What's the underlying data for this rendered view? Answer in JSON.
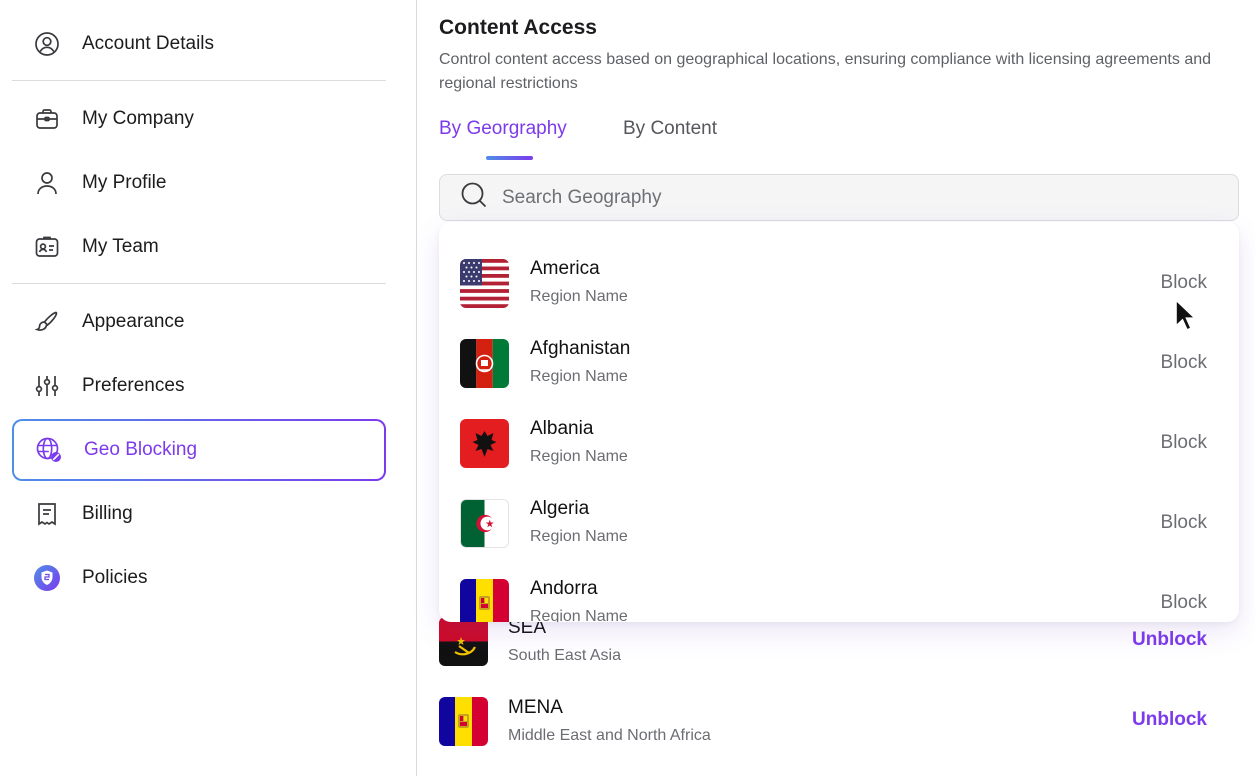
{
  "sidebar": {
    "items": [
      {
        "label": "Account Details",
        "icon": "user-circle-icon"
      },
      {
        "label": "My Company",
        "icon": "briefcase-icon"
      },
      {
        "label": "My Profile",
        "icon": "person-icon"
      },
      {
        "label": "My Team",
        "icon": "id-badge-icon"
      },
      {
        "label": "Appearance",
        "icon": "brush-icon"
      },
      {
        "label": "Preferences",
        "icon": "sliders-icon"
      },
      {
        "label": "Geo Blocking",
        "icon": "globe-block-icon"
      },
      {
        "label": "Billing",
        "icon": "receipt-icon"
      },
      {
        "label": "Policies",
        "icon": "shield-icon"
      }
    ],
    "active": "Geo Blocking"
  },
  "main": {
    "title": "Content Access",
    "subtitle": "Control content access based on geographical locations, ensuring compliance with licensing agreements and regional restrictions",
    "tabs": [
      {
        "label": "By Georgraphy",
        "active": true
      },
      {
        "label": "By Content",
        "active": false
      }
    ],
    "search": {
      "placeholder": "Search Geography"
    },
    "dropdown": [
      {
        "name": "America",
        "sub": "Region Name",
        "action": "Block",
        "flag": "us-flag"
      },
      {
        "name": "Afghanistan",
        "sub": "Region Name",
        "action": "Block",
        "flag": "afghanistan-flag"
      },
      {
        "name": "Albania",
        "sub": "Region Name",
        "action": "Block",
        "flag": "albania-flag"
      },
      {
        "name": "Algeria",
        "sub": "Region Name",
        "action": "Block",
        "flag": "algeria-flag"
      },
      {
        "name": "Andorra",
        "sub": "Region Name",
        "action": "Block",
        "flag": "andorra-flag"
      }
    ],
    "blocked": [
      {
        "name": "SEA",
        "sub": "South East Asia",
        "action": "Unblock",
        "flag": "angola-flag"
      },
      {
        "name": "MENA",
        "sub": "Middle East and North Africa",
        "action": "Unblock",
        "flag": "andorra-flag"
      }
    ]
  },
  "colors": {
    "accent": "#7c3aed",
    "accent_blue": "#4f8ee8",
    "muted": "#6b6d72"
  }
}
